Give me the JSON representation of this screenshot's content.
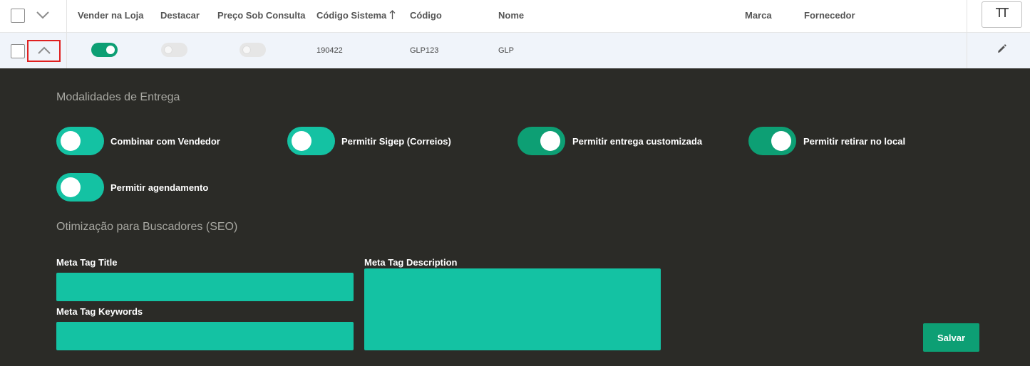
{
  "table": {
    "headers": {
      "vender_na_loja": "Vender na Loja",
      "destacar": "Destacar",
      "preco_sob_consulta": "Preço Sob Consulta",
      "codigo_sistema": "Código Sistema",
      "codigo": "Código",
      "nome": "Nome",
      "marca": "Marca",
      "fornecedor": "Fornecedor"
    },
    "sort_indicator": "↑",
    "row": {
      "vender_na_loja": true,
      "destacar": false,
      "preco_sob_consulta": false,
      "codigo_sistema": "190422",
      "codigo": "GLP123",
      "nome": "GLP",
      "marca": "",
      "fornecedor": ""
    }
  },
  "delivery": {
    "title": "Modalidades de Entrega",
    "options": [
      {
        "label": "Combinar com Vendedor",
        "enabled": false
      },
      {
        "label": "Permitir Sigep (Correios)",
        "enabled": false
      },
      {
        "label": "Permitir entrega customizada",
        "enabled": true
      },
      {
        "label": "Permitir retirar no local",
        "enabled": true
      },
      {
        "label": "Permitir agendamento",
        "enabled": false
      }
    ]
  },
  "seo": {
    "title": "Otimização para Buscadores (SEO)",
    "meta_title_label": "Meta Tag Title",
    "meta_title_value": "",
    "meta_keywords_label": "Meta Tag Keywords",
    "meta_keywords_value": "",
    "meta_description_label": "Meta Tag Description",
    "meta_description_value": ""
  },
  "actions": {
    "save_label": "Salvar"
  },
  "icons": {
    "select_all": "checkbox-icon",
    "expand_all": "chevron-down-icon",
    "collapse_row": "chevron-up-icon",
    "columns": "column-toggle-icon",
    "edit": "pencil-icon"
  },
  "colors": {
    "accent": "#14c2a3",
    "accent_dark": "#0d9f74",
    "panel_bg": "#2b2b27",
    "row_bg": "#f0f4fa",
    "highlight_border": "#e02020"
  }
}
